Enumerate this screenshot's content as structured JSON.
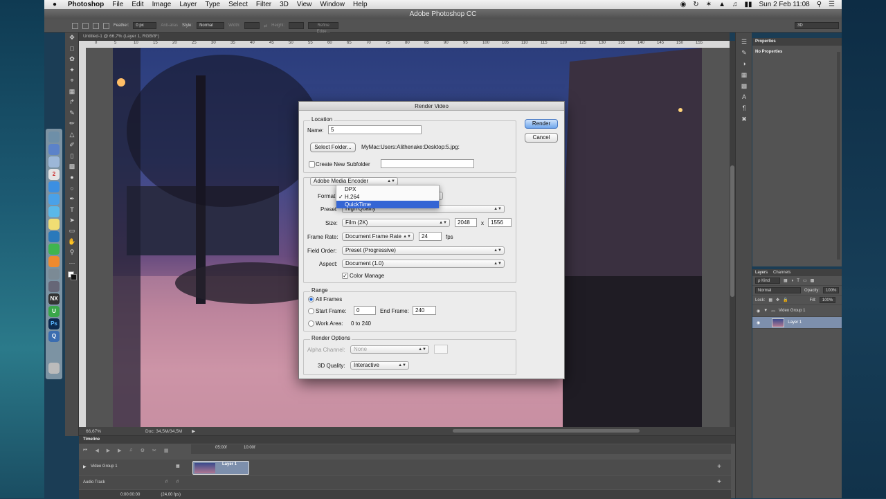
{
  "menubar": {
    "items": [
      "Photoshop",
      "File",
      "Edit",
      "Image",
      "Layer",
      "Type",
      "Select",
      "Filter",
      "3D",
      "View",
      "Window",
      "Help"
    ],
    "clock": "Sun 2 Feb  11:08"
  },
  "window": {
    "title": "Adobe Photoshop CC"
  },
  "options": {
    "feather_label": "Feather:",
    "feather_value": "0 px",
    "antialias": "Anti-alias",
    "style_label": "Style:",
    "style_value": "Normal",
    "width_label": "Width:",
    "height_label": "Height:",
    "refine_edge": "Refine Edge...",
    "workspace": "3D"
  },
  "document": {
    "tab_title": "Untitled-1 @ 66,7% (Layer 1, RGB/8*)",
    "ruler_ticks": [
      "0",
      "5",
      "10",
      "15",
      "20",
      "25",
      "30",
      "35",
      "40",
      "45",
      "50",
      "55",
      "60",
      "65",
      "70",
      "75",
      "80",
      "85",
      "90",
      "95",
      "100",
      "105",
      "110",
      "115",
      "120",
      "125",
      "130",
      "135",
      "140",
      "145",
      "150",
      "155"
    ],
    "zoom": "66,67%",
    "doc_size": "Doc: 34,5M/34,5M"
  },
  "properties": {
    "title": "Properties",
    "body": "No Properties"
  },
  "layers": {
    "tabs": [
      "Layers",
      "Channels"
    ],
    "kind": "ρ Kind",
    "blend": "Normal",
    "opacity_label": "Opacity:",
    "opacity": "100%",
    "lock_label": "Lock:",
    "fill_label": "Fill:",
    "fill": "100%",
    "group": "Video Group 1",
    "layer": "Layer 1"
  },
  "timeline": {
    "title": "Timeline",
    "marks": [
      "05:00f",
      "10:00f"
    ],
    "track": "Video Group 1",
    "clip": "Layer 1",
    "audio": "Audio Track",
    "timecode": "0:00:00:00",
    "fps": "(24,00 fps)"
  },
  "dialog": {
    "title": "Render Video",
    "render": "Render",
    "cancel": "Cancel",
    "location": "Location",
    "name_label": "Name:",
    "name_value": "5",
    "select_folder": "Select Folder...",
    "path": "MyMac:Users:Alithenake:Desktop:5.jpg:",
    "subfolder": "Create New Subfolder",
    "encoder": "Adobe Media Encoder",
    "format_label": "Format",
    "preset_label": "Preset",
    "preset_value": "High Quality",
    "size_label": "Size:",
    "size_value": "Film (2K)",
    "width": "2048",
    "x": "x",
    "height": "1556",
    "frame_rate_label": "Frame Rate:",
    "frame_rate_value": "Document Frame Rate",
    "fps_value": "24",
    "fps_unit": "fps",
    "field_order_label": "Field Order:",
    "field_order_value": "Preset (Progressive)",
    "aspect_label": "Aspect:",
    "aspect_value": "Document (1.0)",
    "color_manage": "Color Manage",
    "range": "Range",
    "all_frames": "All Frames",
    "start_frame_label": "Start Frame:",
    "start_frame": "0",
    "end_frame_label": "End Frame:",
    "end_frame": "240",
    "work_area_label": "Work Area:",
    "work_area": "0 to 240",
    "render_options": "Render Options",
    "alpha_label": "Alpha Channel:",
    "alpha_value": "None",
    "quality_label": "3D Quality:",
    "quality_value": "Interactive"
  },
  "format_menu": {
    "options": [
      "DPX",
      "H.264",
      "QuickTime"
    ],
    "selected": "H.264",
    "highlighted": "QuickTime"
  },
  "colors": {
    "accent": "#3465d4",
    "selection": "#7d8fac",
    "panel": "#535353"
  }
}
